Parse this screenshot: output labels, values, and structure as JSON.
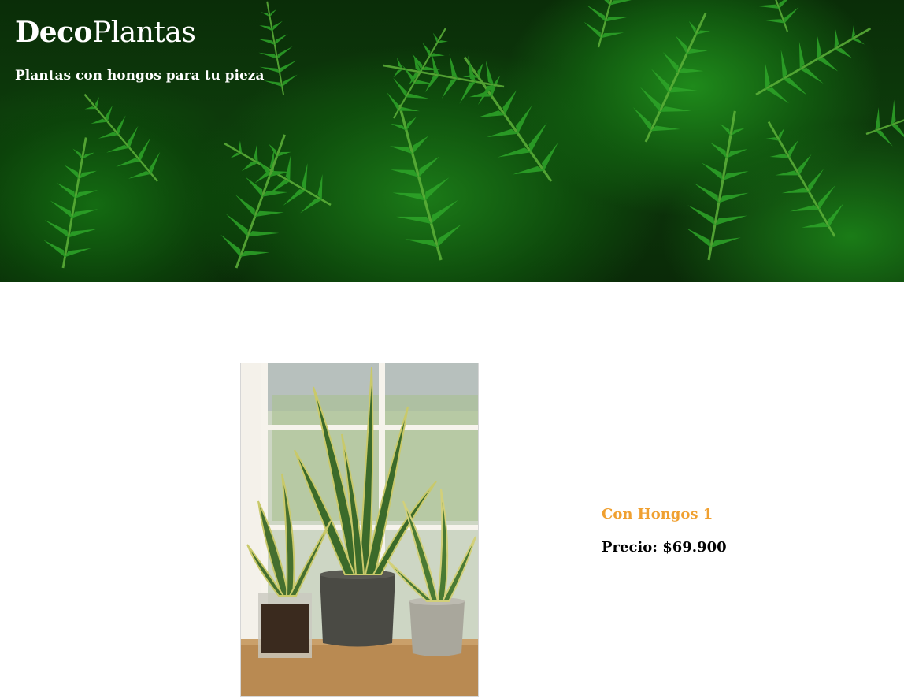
{
  "header": {
    "brand_bold": "Deco",
    "brand_light": "Plantas",
    "tagline": "Plantas con hongos para tu pieza",
    "background_image": "fern-leaves-photo",
    "colors": {
      "brand_text": "#ffffff",
      "foliage": "#1f8a1b"
    }
  },
  "product": {
    "image": "snake-plants-in-pots-photo",
    "name": "Con Hongos 1",
    "price_label": "Precio:",
    "price_value": "$69.900",
    "colors": {
      "name": "#f0a030",
      "price": "#000000"
    }
  }
}
